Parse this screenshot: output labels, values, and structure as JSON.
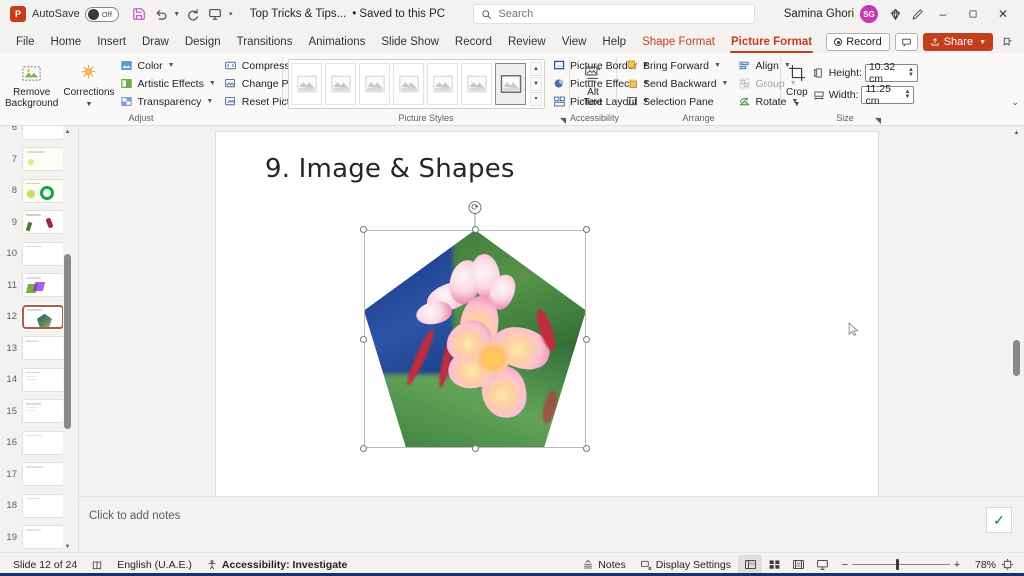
{
  "titlebar": {
    "app_logo": "powerpoint-logo",
    "autosave_label": "AutoSave",
    "autosave_state": "Off",
    "save_icon": "save-icon",
    "undo_icon": "undo-icon",
    "redo_icon": "redo-icon",
    "present_icon": "start-presentation-icon",
    "customize_icon": "customize-quick-access-icon",
    "document_title": "Top Tricks & Tips...",
    "save_state": "• Saved to this PC",
    "user_name": "Samina Ghori",
    "avatar_initials": "SG",
    "diamond_icon": "microsoft-365-copilot-icon",
    "pen_icon": "ink-icon",
    "minimize": "–",
    "restore": "▢",
    "close": "✕"
  },
  "search": {
    "placeholder": "Search",
    "value": "",
    "icon": "search-icon"
  },
  "tabs": {
    "items": [
      {
        "label": "File",
        "active": false,
        "contextual": false
      },
      {
        "label": "Home",
        "active": false,
        "contextual": false
      },
      {
        "label": "Insert",
        "active": false,
        "contextual": false
      },
      {
        "label": "Draw",
        "active": false,
        "contextual": false
      },
      {
        "label": "Design",
        "active": false,
        "contextual": false
      },
      {
        "label": "Transitions",
        "active": false,
        "contextual": false
      },
      {
        "label": "Animations",
        "active": false,
        "contextual": false
      },
      {
        "label": "Slide Show",
        "active": false,
        "contextual": false
      },
      {
        "label": "Record",
        "active": false,
        "contextual": false
      },
      {
        "label": "Review",
        "active": false,
        "contextual": false
      },
      {
        "label": "View",
        "active": false,
        "contextual": false
      },
      {
        "label": "Help",
        "active": false,
        "contextual": false
      },
      {
        "label": "Shape Format",
        "active": false,
        "contextual": true
      },
      {
        "label": "Picture Format",
        "active": true,
        "contextual": true
      }
    ],
    "record_button": "Record",
    "comment_icon": "comment-icon",
    "share_button": "Share",
    "ribbon_display_icon": "ribbon-display-options-icon"
  },
  "ribbon": {
    "adjust": {
      "label": "Adjust",
      "remove_background": "Remove Background",
      "corrections": "Corrections",
      "color": "Color",
      "artistic_effects": "Artistic Effects",
      "transparency": "Transparency",
      "compress_pictures": "Compress Pictures",
      "change_picture": "Change Picture",
      "reset_picture": "Reset Picture"
    },
    "picture_styles": {
      "label": "Picture Styles",
      "thumb_count": 7,
      "selected_index": 6,
      "scroll_up": "▲",
      "scroll_down": "▼",
      "more": "▾",
      "picture_border": "Picture Border",
      "picture_effects": "Picture Effects",
      "picture_layout": "Picture Layout"
    },
    "accessibility": {
      "label": "Accessibility",
      "alt_text": "Alt\nText",
      "alt_text_line1": "Alt",
      "alt_text_line2": "Text"
    },
    "arrange": {
      "label": "Arrange",
      "bring_forward": "Bring Forward",
      "send_backward": "Send Backward",
      "selection_pane": "Selection Pane",
      "align": "Align",
      "group": "Group",
      "group_disabled": true,
      "rotate": "Rotate"
    },
    "size": {
      "label": "Size",
      "crop": "Crop",
      "height_label": "Height:",
      "height_value": "10.32 cm",
      "width_label": "Width:",
      "width_value": "11.25 cm"
    },
    "collapse_icon": "collapse-ribbon-icon"
  },
  "thumbnails": {
    "slides": [
      {
        "number": "6"
      },
      {
        "number": "7"
      },
      {
        "number": "8"
      },
      {
        "number": "9"
      },
      {
        "number": "10"
      },
      {
        "number": "11"
      },
      {
        "number": "12"
      },
      {
        "number": "13"
      },
      {
        "number": "14"
      },
      {
        "number": "15"
      },
      {
        "number": "16"
      },
      {
        "number": "17"
      },
      {
        "number": "18"
      },
      {
        "number": "19"
      }
    ],
    "active_number": "12"
  },
  "slide": {
    "title": "9. Image & Shapes",
    "picture": {
      "name": "pentagon-cropped-flower-picture",
      "shape": "pentagon",
      "selected": true,
      "rotation_handle": "rotation-handle"
    }
  },
  "notes": {
    "placeholder": "Click to add notes",
    "accept_icon": "accept-check-icon"
  },
  "statusbar": {
    "slide_counter": "Slide 12 of 24",
    "book_icon": "spelling-icon",
    "language": "English (U.A.E.)",
    "accessibility": "Accessibility: Investigate",
    "notes_button": "Notes",
    "display_settings": "Display Settings",
    "view_normal": "normal-view-icon",
    "view_sorter": "slide-sorter-icon",
    "view_reading": "reading-view-icon",
    "view_slideshow": "slideshow-view-icon",
    "zoom_out": "−",
    "zoom_in": "+",
    "zoom_level": "78%",
    "fit_to_window": "fit-slide-to-window-icon"
  },
  "colors": {
    "accent": "#c43e1c",
    "avatar": "#c239b3",
    "selection_border": "#b05c4a",
    "taskbar": "#14326e"
  }
}
